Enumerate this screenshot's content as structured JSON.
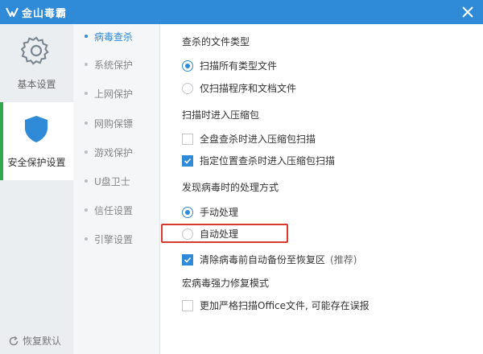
{
  "window": {
    "title": "金山毒霸",
    "accent": "#2f8ad8"
  },
  "categories": [
    {
      "label": "基本设置",
      "icon": "gear-icon",
      "active": false
    },
    {
      "label": "安全保护设置",
      "icon": "shield-icon",
      "active": true
    }
  ],
  "restore_label": "恢复默认",
  "subnav": [
    "病毒查杀",
    "系统保护",
    "上网保护",
    "网购保镖",
    "游戏保护",
    "U盘卫士",
    "信任设置",
    "引擎设置"
  ],
  "sections": {
    "file_types": {
      "heading": "查杀的文件类型",
      "options": [
        {
          "label": "扫描所有类型文件",
          "checked": true
        },
        {
          "label": "仅扫描程序和文档文件",
          "checked": false
        }
      ]
    },
    "archives": {
      "heading": "扫描时进入压缩包",
      "options": [
        {
          "label": "全盘查杀时进入压缩包扫描",
          "checked": false
        },
        {
          "label": "指定位置查杀时进入压缩包扫描",
          "checked": true
        }
      ]
    },
    "on_virus": {
      "heading": "发现病毒时的处理方式",
      "options": [
        {
          "label": "手动处理",
          "checked": true
        },
        {
          "label": "自动处理",
          "checked": false
        }
      ],
      "backup": {
        "label": "清除病毒前自动备份至恢复区",
        "note": "(推荐)",
        "checked": true
      }
    },
    "macro": {
      "heading": "宏病毒强力修复模式",
      "options": [
        {
          "label": "更加严格扫描Office文件, 可能存在误报",
          "checked": false
        }
      ]
    }
  },
  "highlight_color": "#d93a30"
}
